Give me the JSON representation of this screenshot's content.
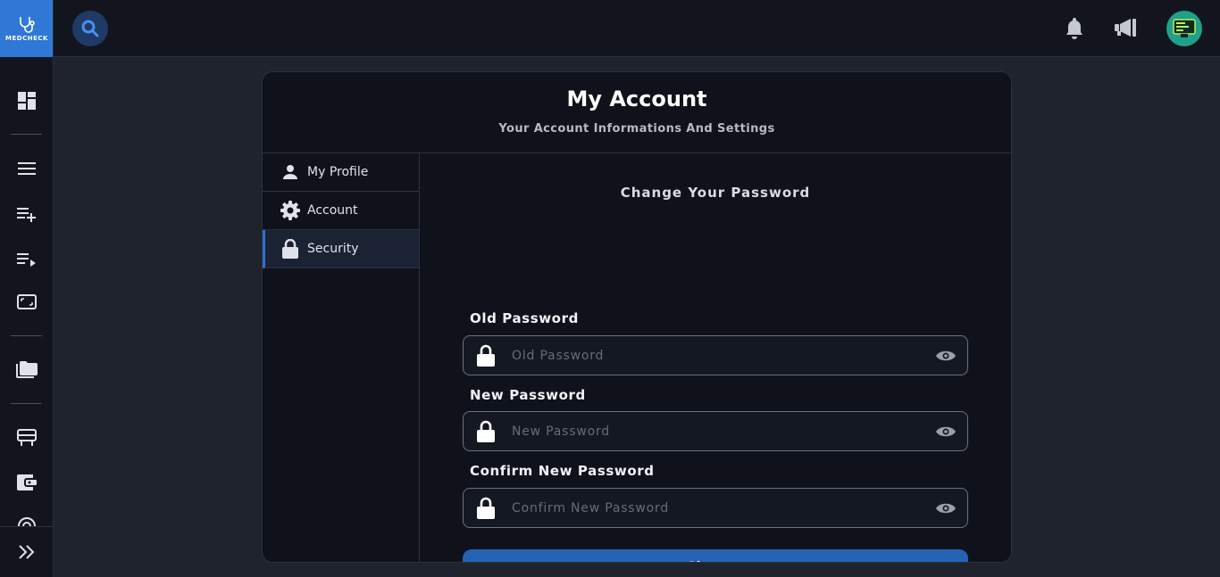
{
  "app": {
    "logo_text": "MEDCHECK"
  },
  "page": {
    "title": "My Account",
    "subtitle": "Your Account Informations And Settings"
  },
  "tabs": [
    {
      "label": "My Profile",
      "icon": "person-icon",
      "active": false
    },
    {
      "label": "Account",
      "icon": "gear-icon",
      "active": false
    },
    {
      "label": "Security",
      "icon": "lock-icon",
      "active": true
    }
  ],
  "form": {
    "title": "Change Your Password",
    "old": {
      "label": "Old Password",
      "placeholder": "Old Password",
      "value": ""
    },
    "new": {
      "label": "New Password",
      "placeholder": "New Password",
      "value": ""
    },
    "confirm": {
      "label": "Confirm New Password",
      "placeholder": "Confirm New Password",
      "value": ""
    },
    "submit_label": "Change"
  },
  "colors": {
    "accent": "#2f78d6",
    "button": "#2463b3",
    "background": "#1f232d",
    "panel": "#0f121a"
  }
}
